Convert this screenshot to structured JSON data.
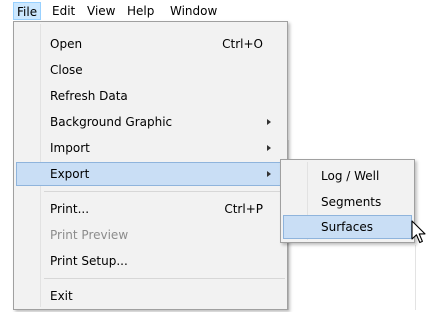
{
  "menubar": {
    "items": [
      {
        "label": "File",
        "open": true
      },
      {
        "label": "Edit"
      },
      {
        "label": "View"
      },
      {
        "label": "Help"
      },
      {
        "label": "Window"
      }
    ]
  },
  "file_menu": {
    "items": [
      {
        "label": "Open",
        "shortcut": "Ctrl+O"
      },
      {
        "label": "Close"
      },
      {
        "label": "Refresh Data"
      },
      {
        "label": "Background Graphic",
        "submenu": true
      },
      {
        "label": "Import",
        "submenu": true
      },
      {
        "label": "Export",
        "submenu": true,
        "highlighted": true
      },
      {
        "label": "Print...",
        "shortcut": "Ctrl+P"
      },
      {
        "label": "Print Preview",
        "disabled": true
      },
      {
        "label": "Print Setup..."
      },
      {
        "label": "Exit"
      }
    ]
  },
  "export_submenu": {
    "items": [
      {
        "label": "Log / Well"
      },
      {
        "label": "Segments"
      },
      {
        "label": "Surfaces",
        "highlighted": true
      }
    ]
  },
  "cursor": {
    "icon": "mouse-pointer-icon"
  }
}
